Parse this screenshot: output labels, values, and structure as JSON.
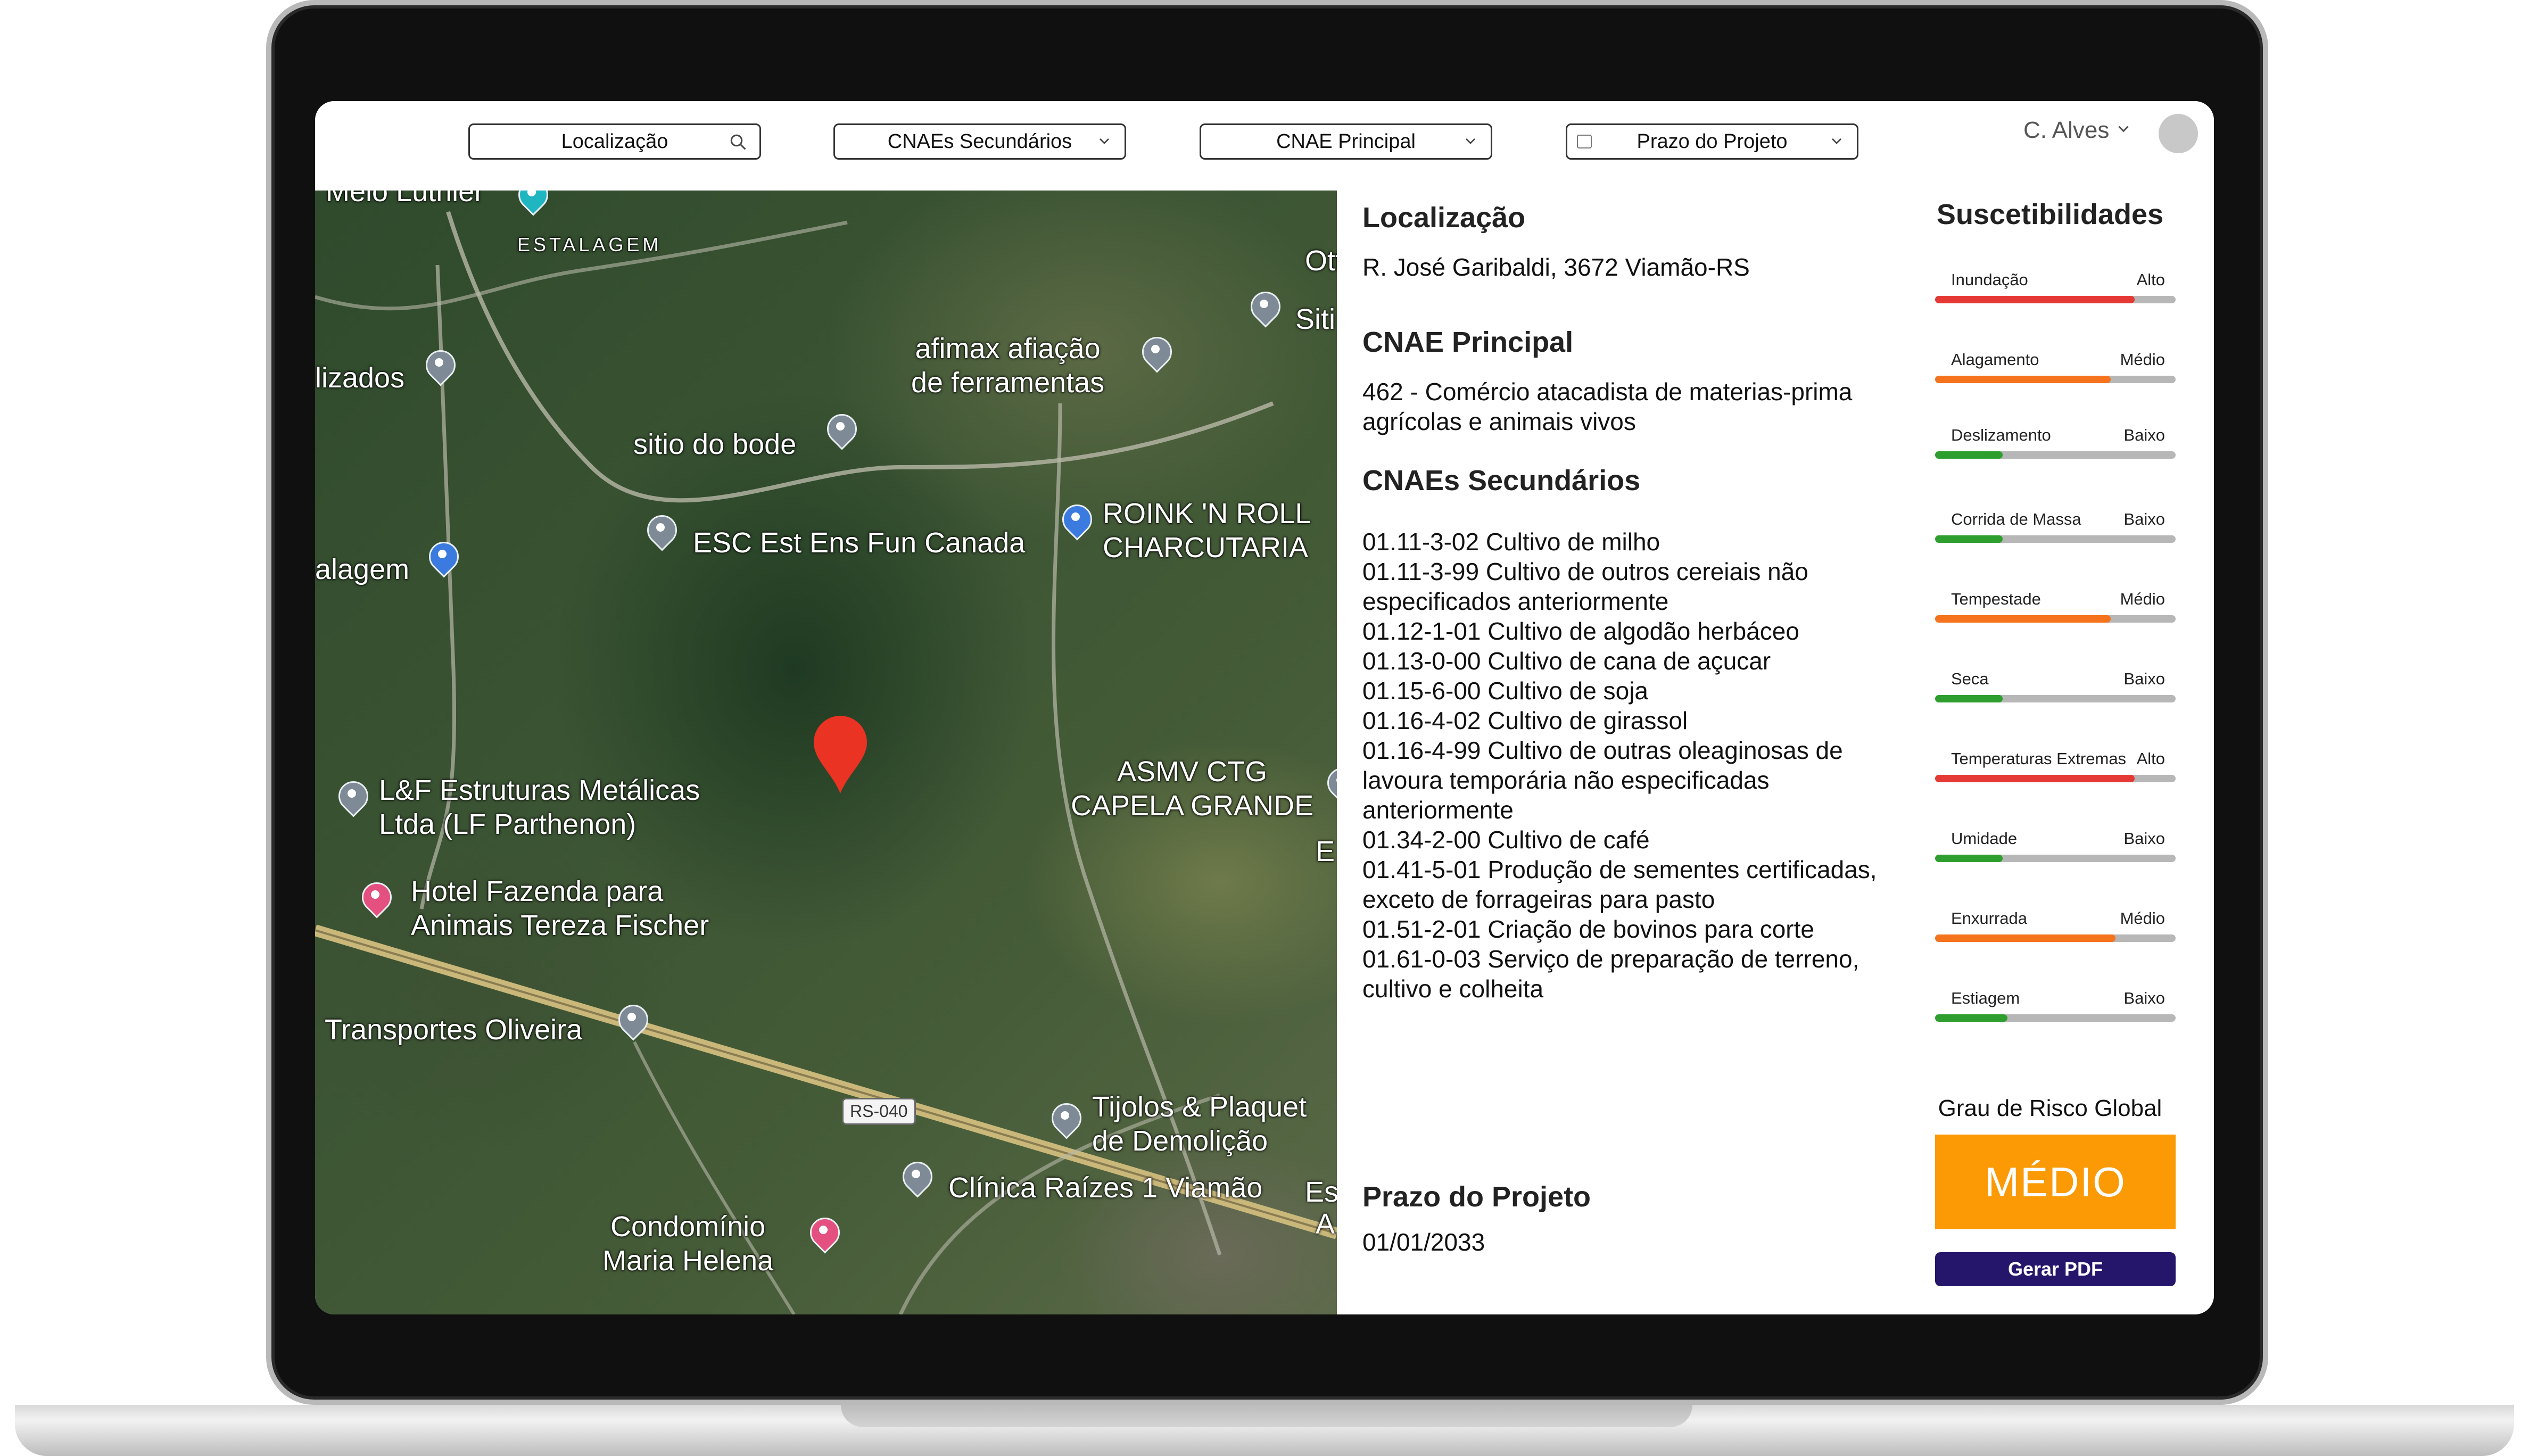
{
  "filters": {
    "location": "Localização",
    "secondary_cnaes": "CNAEs Secundários",
    "primary_cnae": "CNAE Principal",
    "deadline": "Prazo do Projeto"
  },
  "user": {
    "name": "C. Alves"
  },
  "map": {
    "places": {
      "estalagem": "ESTALAGEM",
      "melo_luthier": "Melo Luthier",
      "lizados": "lizados",
      "alagem": "alagem",
      "ott": "Ott",
      "siti": "Siti",
      "afimax": "afimax afiação\nde ferramentas",
      "sitio_bode": "sitio do bode",
      "esc": "ESC Est Ens Fun Canada",
      "roink": "ROINK 'N ROLL\nCHARCUTARIA",
      "lf": "L&F Estruturas Metálicas\nLtda (LF Parthenon)",
      "asmv": "ASMV CTG\nCAPELA GRANDE",
      "hotel": "Hotel Fazenda para\nAnimais Tereza Fischer",
      "transportes": "Transportes Oliveira",
      "tijolos": "Tijolos & Plaquet\nde Demolição",
      "clinica": "Clínica Raízes 1 Viamão",
      "condominio": "Condomínio\nMaria Helena",
      "es": "Es",
      "a": "A",
      "e": "E"
    },
    "road_shield": "RS-040"
  },
  "detail": {
    "location_title": "Localização",
    "location_value": "R. José Garibaldi, 3672 Viamão-RS",
    "cnae_title": "CNAE Principal",
    "cnae_value": "462 - Comércio atacadista de materias-prima agrícolas e animais vivos",
    "secondary_title": "CNAEs Secundários",
    "secondary_items": [
      "01.11-3-02  Cultivo de milho",
      "01.11-3-99 Cultivo de outros cereiais não especificados anteriormente",
      "01.12-1-01 Cultivo de algodão herbáceo",
      "01.13-0-00 Cultivo de cana de açucar",
      "01.15-6-00 Cultivo de soja",
      "01.16-4-02 Cultivo de girassol",
      "01.16-4-99 Cultivo de outras oleaginosas de lavoura temporária não especificadas anteriormente",
      "01.34-2-00 Cultivo de café",
      "01.41-5-01 Produção de sementes certificadas, exceto de forrageiras para pasto",
      "01.51-2-01 Criação de bovinos para corte",
      "01.61-0-03 Serviço de preparação de terreno, cultivo e colheita"
    ],
    "deadline_title": "Prazo do Projeto",
    "deadline_value": "01/01/2033"
  },
  "susceptibilities": {
    "title": "Suscetibilidades",
    "colors": {
      "Alto": "#e53935",
      "Médio": "#f5731c",
      "Baixo": "#2e9e2e"
    },
    "items": [
      {
        "name": "Inundação",
        "level": "Alto",
        "fill": 0.83
      },
      {
        "name": "Alagamento",
        "level": "Médio",
        "fill": 0.73
      },
      {
        "name": "Deslizamento",
        "level": "Baixo",
        "fill": 0.28
      },
      {
        "name": "Corrida de Massa",
        "level": "Baixo",
        "fill": 0.28
      },
      {
        "name": "Tempestade",
        "level": "Médio",
        "fill": 0.73
      },
      {
        "name": "Seca",
        "level": "Baixo",
        "fill": 0.28
      },
      {
        "name": "Temperaturas Extremas",
        "level": "Alto",
        "fill": 0.83
      },
      {
        "name": "Umidade",
        "level": "Baixo",
        "fill": 0.28
      },
      {
        "name": "Enxurrada",
        "level": "Médio",
        "fill": 0.75
      },
      {
        "name": "Estiagem",
        "level": "Baixo",
        "fill": 0.3
      }
    ],
    "global_label": "Grau de Risco Global",
    "global_value": "MÉDIO",
    "global_color": "#fb9a05",
    "pdf_button": "Gerar PDF"
  }
}
